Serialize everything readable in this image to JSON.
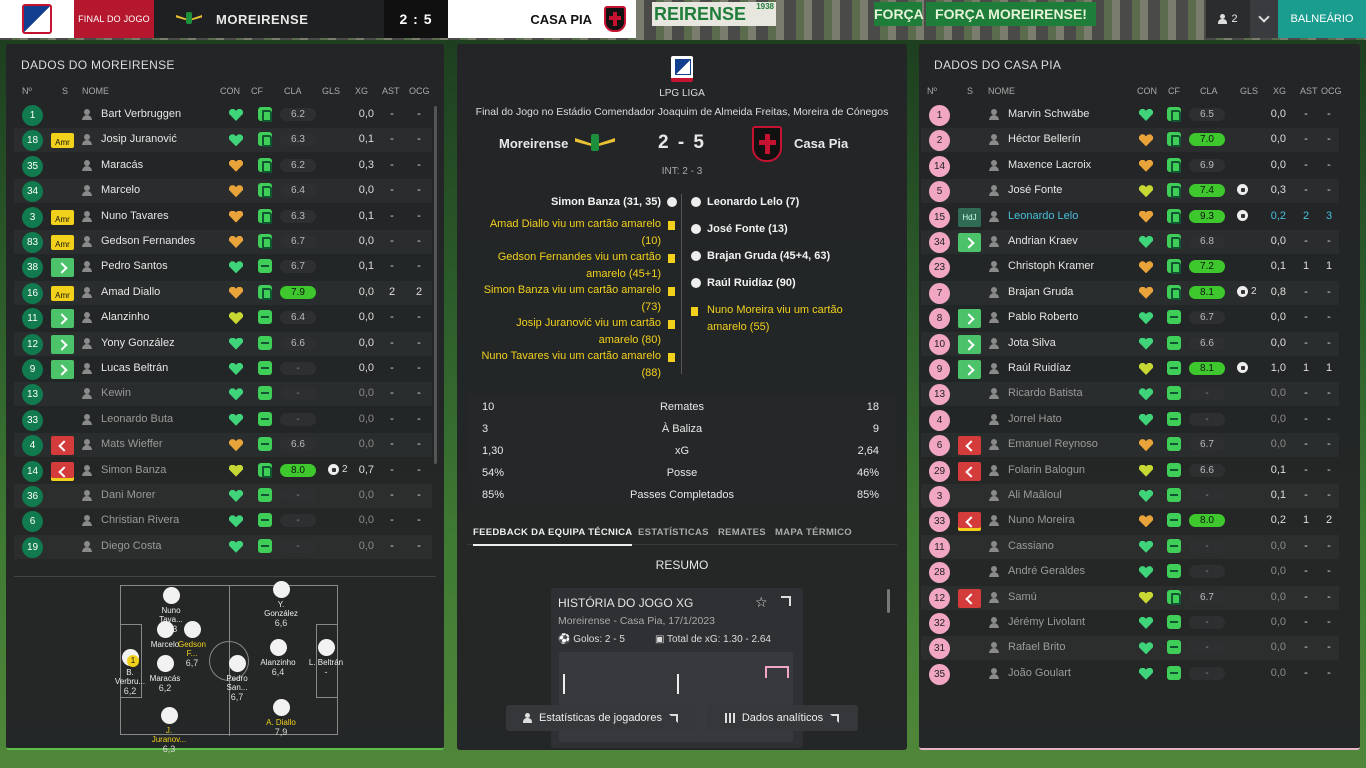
{
  "topbar": {
    "stage": "FINAL DO JOGO",
    "home_team": "MOREIRENSE",
    "score": "2 : 5",
    "away_team": "CASA PIA",
    "banner_1": "REIRENSE",
    "banner_1_year": "1938",
    "banner_2": "FORÇA",
    "banner_3": "FORÇA MOREIRENSE!",
    "users_count": "2",
    "balneario": "BALNEÁRIO"
  },
  "headers": [
    "Nº",
    "S",
    "NOME",
    "CON",
    "CF",
    "CLA",
    "GLS",
    "XG",
    "AST",
    "OCG"
  ],
  "left": {
    "title": "DADOS DO MOREIRENSE",
    "players": [
      {
        "n": "1",
        "s": "",
        "name": "Bart Verbruggen",
        "con": "g",
        "cf": "hand",
        "cla": "6.2",
        "cla_hl": false,
        "gls": "",
        "xg": "0,0",
        "ast": "-",
        "ocg": "-"
      },
      {
        "n": "18",
        "s": "amr",
        "name": "Josip Juranović",
        "con": "g",
        "cf": "hand",
        "cla": "6.3",
        "cla_hl": false,
        "gls": "",
        "xg": "0,1",
        "ast": "-",
        "ocg": "-"
      },
      {
        "n": "35",
        "s": "",
        "name": "Maracás",
        "con": "o",
        "cf": "hand",
        "cla": "6.2",
        "cla_hl": false,
        "gls": "",
        "xg": "0,3",
        "ast": "-",
        "ocg": "-"
      },
      {
        "n": "34",
        "s": "",
        "name": "Marcelo",
        "con": "o",
        "cf": "hand",
        "cla": "6.4",
        "cla_hl": false,
        "gls": "",
        "xg": "0,0",
        "ast": "-",
        "ocg": "-"
      },
      {
        "n": "3",
        "s": "amr",
        "name": "Nuno Tavares",
        "con": "o",
        "cf": "hand",
        "cla": "6.3",
        "cla_hl": false,
        "gls": "",
        "xg": "0,1",
        "ast": "-",
        "ocg": "-"
      },
      {
        "n": "83",
        "s": "amr",
        "name": "Gedson Fernandes",
        "con": "o",
        "cf": "hand",
        "cla": "6.7",
        "cla_hl": false,
        "gls": "",
        "xg": "0,0",
        "ast": "-",
        "ocg": "-"
      },
      {
        "n": "38",
        "s": "in",
        "name": "Pedro Santos",
        "con": "g",
        "cf": "minus",
        "cla": "6.7",
        "cla_hl": false,
        "gls": "",
        "xg": "0,1",
        "ast": "-",
        "ocg": "-"
      },
      {
        "n": "16",
        "s": "amr",
        "name": "Amad Diallo",
        "con": "o",
        "cf": "hand",
        "cla": "7.9",
        "cla_hl": true,
        "gls": "",
        "xg": "0,0",
        "ast": "2",
        "ocg": "2"
      },
      {
        "n": "11",
        "s": "in",
        "name": "Alanzinho",
        "con": "y",
        "cf": "minus",
        "cla": "6.4",
        "cla_hl": false,
        "gls": "",
        "xg": "0,0",
        "ast": "-",
        "ocg": "-"
      },
      {
        "n": "12",
        "s": "in",
        "name": "Yony González",
        "con": "g",
        "cf": "minus",
        "cla": "6.6",
        "cla_hl": false,
        "gls": "",
        "xg": "0,0",
        "ast": "-",
        "ocg": "-"
      },
      {
        "n": "9",
        "s": "in",
        "name": "Lucas Beltrán",
        "con": "g",
        "cf": "minus",
        "cla": "-",
        "cla_hl": false,
        "gls": "",
        "xg": "0,0",
        "ast": "-",
        "ocg": "-"
      },
      {
        "n": "13",
        "s": "",
        "name": "Kewin",
        "con": "g",
        "cf": "minus",
        "cla": "-",
        "cla_hl": false,
        "gls": "",
        "xg": "0,0",
        "ast": "-",
        "ocg": "-",
        "dim": true
      },
      {
        "n": "33",
        "s": "",
        "name": "Leonardo Buta",
        "con": "g",
        "cf": "minus",
        "cla": "-",
        "cla_hl": false,
        "gls": "",
        "xg": "0,0",
        "ast": "-",
        "ocg": "-",
        "dim": true
      },
      {
        "n": "4",
        "s": "out",
        "name": "Mats Wieffer",
        "con": "o",
        "cf": "minus",
        "cla": "6.6",
        "cla_hl": false,
        "gls": "",
        "xg": "0,0",
        "ast": "-",
        "ocg": "-",
        "dim": true
      },
      {
        "n": "14",
        "s": "outy",
        "name": "Simon Banza",
        "con": "y",
        "cf": "hand",
        "cla": "8.0",
        "cla_hl": true,
        "gls": "2",
        "xg": "0,7",
        "ast": "-",
        "ocg": "-",
        "dim": true
      },
      {
        "n": "36",
        "s": "",
        "name": "Dani Morer",
        "con": "g",
        "cf": "minus",
        "cla": "-",
        "cla_hl": false,
        "gls": "",
        "xg": "0,0",
        "ast": "-",
        "ocg": "-",
        "dim": true
      },
      {
        "n": "6",
        "s": "",
        "name": "Christian Rivera",
        "con": "g",
        "cf": "minus",
        "cla": "-",
        "cla_hl": false,
        "gls": "",
        "xg": "0,0",
        "ast": "-",
        "ocg": "-",
        "dim": true
      },
      {
        "n": "19",
        "s": "",
        "name": "Diego Costa",
        "con": "g",
        "cf": "minus",
        "cla": "-",
        "cla_hl": false,
        "gls": "",
        "xg": "0,0",
        "ast": "-",
        "ocg": "-",
        "dim": true
      }
    ],
    "pitch": [
      {
        "name": "Nuno Tava...",
        "rating": "6,3",
        "yellow": false
      },
      {
        "name": "Y. González",
        "rating": "6,6",
        "yellow": false
      },
      {
        "name": "Marcelo",
        "rating": "",
        "yellow": false
      },
      {
        "name": "Gedson F...",
        "rating": "6,7",
        "yellow": true
      },
      {
        "name": "B. Verbru...",
        "rating": "6,2",
        "yellow": false
      },
      {
        "name": "Alanzinho",
        "rating": "6,4",
        "yellow": false
      },
      {
        "name": "L. Beltrán",
        "rating": "-",
        "yellow": false
      },
      {
        "name": "Maracás",
        "rating": "6,2",
        "yellow": false
      },
      {
        "name": "Pedro San...",
        "rating": "6,7",
        "yellow": false
      },
      {
        "name": "J. Juranov...",
        "rating": "6,3",
        "yellow": true
      },
      {
        "name": "A. Diallo",
        "rating": "7,9",
        "yellow": true
      }
    ],
    "captain_mark": "1"
  },
  "center": {
    "league": "LPG LIGA",
    "venue": "Final do Jogo no Estádio Comendador Joaquim de Almeida Freitas, Moreira de Cónegos",
    "home": "Moreirense",
    "score": "2 - 5",
    "away": "Casa Pia",
    "int": "INT: 2 - 3",
    "home_events": [
      {
        "type": "goal",
        "text": "Simon Banza (31, 35)"
      },
      {
        "type": "card",
        "text": "Amad Diallo viu um cartão amarelo (10)"
      },
      {
        "type": "card",
        "text": "Gedson Fernandes viu um cartão amarelo (45+1)"
      },
      {
        "type": "card",
        "text": "Simon Banza viu um cartão amarelo (73)"
      },
      {
        "type": "card",
        "text": "Josip Juranović viu um cartão amarelo (80)"
      },
      {
        "type": "card",
        "text": "Nuno Tavares viu um cartão amarelo (88)"
      }
    ],
    "away_events": [
      {
        "type": "goal",
        "text": "Leonardo Lelo (7)"
      },
      {
        "type": "goal",
        "text": "José Fonte (13)"
      },
      {
        "type": "goal",
        "text": "Brajan Gruda (45+4, 63)"
      },
      {
        "type": "goal",
        "text": "Raúl Ruidíaz (90)"
      },
      {
        "type": "card",
        "text": "Nuno Moreira viu um cartão amarelo (55)"
      }
    ],
    "stats": [
      {
        "home": "10",
        "label": "Remates",
        "away": "18"
      },
      {
        "home": "3",
        "label": "À Baliza",
        "away": "9"
      },
      {
        "home": "1,30",
        "label": "xG",
        "away": "2,64"
      },
      {
        "home": "54%",
        "label": "Posse",
        "away": "46%"
      },
      {
        "home": "85%",
        "label": "Passes Completados",
        "away": "85%"
      }
    ],
    "tabs": [
      "FEEDBACK DA EQUIPA TÉCNICA",
      "ESTATÍSTICAS",
      "REMATES",
      "MAPA TÉRMICO"
    ],
    "resumo": "RESUMO",
    "xg_card": {
      "title": "HISTÓRIA DO JOGO XG",
      "subtitle": "Moreirense - Casa Pia, 17/1/2023",
      "goals": "Golos: 2 - 5",
      "xg_total": "Total de xG: 1.30 - 2.64"
    },
    "btn_players": "Estatísticas de jogadores",
    "btn_analytics": "Dados analíticos"
  },
  "right": {
    "title": "DADOS DO CASA PIA",
    "players": [
      {
        "n": "1",
        "s": "",
        "name": "Marvin Schwäbe",
        "con": "g",
        "cf": "hand",
        "cla": "6.5",
        "cla_hl": false,
        "gls": "",
        "xg": "0,0",
        "ast": "-",
        "ocg": "-"
      },
      {
        "n": "2",
        "s": "",
        "name": "Héctor Bellerín",
        "con": "o",
        "cf": "hand",
        "cla": "7.0",
        "cla_hl": true,
        "gls": "",
        "xg": "0,0",
        "ast": "-",
        "ocg": "-"
      },
      {
        "n": "14",
        "s": "",
        "name": "Maxence Lacroix",
        "con": "o",
        "cf": "hand",
        "cla": "6.9",
        "cla_hl": false,
        "gls": "",
        "xg": "0,0",
        "ast": "-",
        "ocg": "-"
      },
      {
        "n": "5",
        "s": "",
        "name": "José Fonte",
        "con": "y",
        "cf": "hand",
        "cla": "7.4",
        "cla_hl": true,
        "gls": "1",
        "xg": "0,3",
        "ast": "-",
        "ocg": "-"
      },
      {
        "n": "15",
        "s": "hdj",
        "name": "Leonardo Lelo",
        "con": "o",
        "cf": "hand",
        "cla": "9.3",
        "cla_hl": true,
        "gls": "1",
        "xg": "0,2",
        "ast": "2",
        "ocg": "3",
        "hl": true
      },
      {
        "n": "34",
        "s": "in",
        "name": "Andrian Kraev",
        "con": "g",
        "cf": "hand",
        "cla": "6.8",
        "cla_hl": false,
        "gls": "",
        "xg": "0,0",
        "ast": "-",
        "ocg": "-"
      },
      {
        "n": "23",
        "s": "",
        "name": "Christoph Kramer",
        "con": "o",
        "cf": "hand",
        "cla": "7.2",
        "cla_hl": true,
        "gls": "",
        "xg": "0,1",
        "ast": "1",
        "ocg": "1"
      },
      {
        "n": "7",
        "s": "",
        "name": "Brajan Gruda",
        "con": "o",
        "cf": "hand",
        "cla": "8.1",
        "cla_hl": true,
        "gls": "2",
        "xg": "0,8",
        "ast": "-",
        "ocg": "-"
      },
      {
        "n": "8",
        "s": "in",
        "name": "Pablo Roberto",
        "con": "g",
        "cf": "minus",
        "cla": "6.7",
        "cla_hl": false,
        "gls": "",
        "xg": "0,0",
        "ast": "-",
        "ocg": "-"
      },
      {
        "n": "10",
        "s": "in",
        "name": "Jota Silva",
        "con": "g",
        "cf": "minus",
        "cla": "6.6",
        "cla_hl": false,
        "gls": "",
        "xg": "0,0",
        "ast": "-",
        "ocg": "-"
      },
      {
        "n": "9",
        "s": "in",
        "name": "Raúl Ruidíaz",
        "con": "y",
        "cf": "minus",
        "cla": "8.1",
        "cla_hl": true,
        "gls": "1",
        "xg": "1,0",
        "ast": "1",
        "ocg": "1"
      },
      {
        "n": "13",
        "s": "",
        "name": "Ricardo Batista",
        "con": "g",
        "cf": "minus",
        "cla": "-",
        "cla_hl": false,
        "gls": "",
        "xg": "0,0",
        "ast": "-",
        "ocg": "-",
        "dim": true
      },
      {
        "n": "4",
        "s": "",
        "name": "Jorrel Hato",
        "con": "g",
        "cf": "minus",
        "cla": "-",
        "cla_hl": false,
        "gls": "",
        "xg": "0,0",
        "ast": "-",
        "ocg": "-",
        "dim": true
      },
      {
        "n": "6",
        "s": "out",
        "name": "Emanuel Reynoso",
        "con": "o",
        "cf": "minus",
        "cla": "6.7",
        "cla_hl": false,
        "gls": "",
        "xg": "0,0",
        "ast": "-",
        "ocg": "-",
        "dim": true
      },
      {
        "n": "29",
        "s": "out",
        "name": "Folarin Balogun",
        "con": "y",
        "cf": "minus",
        "cla": "6.6",
        "cla_hl": false,
        "gls": "",
        "xg": "0,1",
        "ast": "-",
        "ocg": "-",
        "dim": true
      },
      {
        "n": "3",
        "s": "",
        "name": "Ali Maâloul",
        "con": "g",
        "cf": "minus",
        "cla": "-",
        "cla_hl": false,
        "gls": "",
        "xg": "0,1",
        "ast": "-",
        "ocg": "-",
        "dim": true
      },
      {
        "n": "33",
        "s": "outy",
        "name": "Nuno Moreira",
        "con": "o",
        "cf": "minus",
        "cla": "8.0",
        "cla_hl": true,
        "gls": "",
        "xg": "0,2",
        "ast": "1",
        "ocg": "2",
        "dim": true
      },
      {
        "n": "11",
        "s": "",
        "name": "Cassiano",
        "con": "g",
        "cf": "minus",
        "cla": "-",
        "cla_hl": false,
        "gls": "",
        "xg": "0,0",
        "ast": "-",
        "ocg": "-",
        "dim": true
      },
      {
        "n": "28",
        "s": "",
        "name": "André Geraldes",
        "con": "g",
        "cf": "minus",
        "cla": "-",
        "cla_hl": false,
        "gls": "",
        "xg": "0,0",
        "ast": "-",
        "ocg": "-",
        "dim": true
      },
      {
        "n": "12",
        "s": "out",
        "name": "Samú",
        "con": "y",
        "cf": "hand",
        "cla": "6.7",
        "cla_hl": false,
        "gls": "",
        "xg": "0,0",
        "ast": "-",
        "ocg": "-",
        "dim": true
      },
      {
        "n": "32",
        "s": "",
        "name": "Jérémy Livolant",
        "con": "g",
        "cf": "minus",
        "cla": "-",
        "cla_hl": false,
        "gls": "",
        "xg": "0,0",
        "ast": "-",
        "ocg": "-",
        "dim": true
      },
      {
        "n": "31",
        "s": "",
        "name": "Rafael Brito",
        "con": "g",
        "cf": "minus",
        "cla": "-",
        "cla_hl": false,
        "gls": "",
        "xg": "0,0",
        "ast": "-",
        "ocg": "-",
        "dim": true
      },
      {
        "n": "35",
        "s": "",
        "name": "João Goulart",
        "con": "g",
        "cf": "minus",
        "cla": "-",
        "cla_hl": false,
        "gls": "",
        "xg": "0,0",
        "ast": "-",
        "ocg": "-",
        "dim": true
      }
    ]
  },
  "colors": {
    "home_num": "#117a4f",
    "away_num": "#f1a7c3",
    "rating_green": "#3ec82e",
    "card_yellow": "#f2d11d",
    "accent_teal": "#1a9c8e"
  }
}
